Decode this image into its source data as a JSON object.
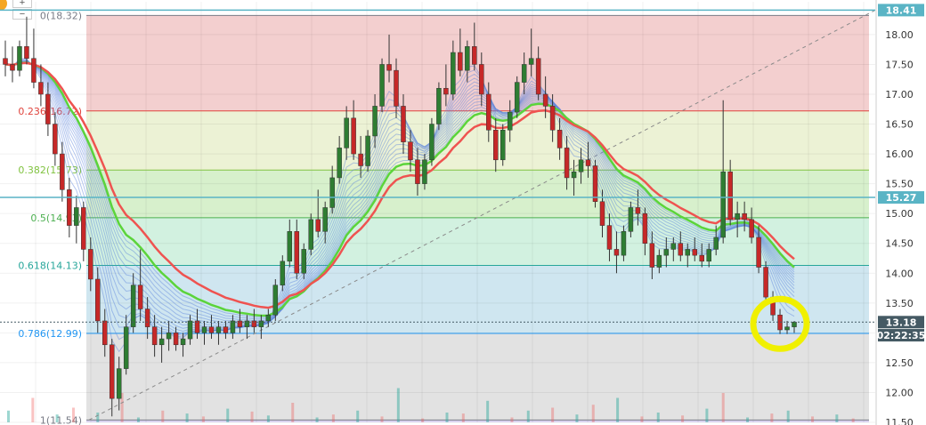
{
  "chart_data": {
    "type": "candlestick",
    "title": "",
    "ylim": [
      11.5,
      18.55
    ],
    "y_ticks": [
      "18.00",
      "17.50",
      "17.00",
      "16.50",
      "16.00",
      "15.50",
      "15.00",
      "14.50",
      "14.00",
      "13.50",
      "13.00",
      "12.50",
      "12.00",
      "11.50"
    ],
    "fib_levels": [
      {
        "label": "0(18.32)",
        "ratio": 0,
        "price": 18.32,
        "color": "#787b86"
      },
      {
        "label": "0.236(16.72)",
        "ratio": 0.236,
        "price": 16.72,
        "color": "#e0433c"
      },
      {
        "label": "0.382(15.73)",
        "ratio": 0.382,
        "price": 15.73,
        "color": "#81c341"
      },
      {
        "label": "0.5(14.93)",
        "ratio": 0.5,
        "price": 14.93,
        "color": "#4caf50"
      },
      {
        "label": "0.618(14.13)",
        "ratio": 0.618,
        "price": 14.13,
        "color": "#26a69a"
      },
      {
        "label": "0.786(12.99)",
        "ratio": 0.786,
        "price": 12.99,
        "color": "#2196f3"
      },
      {
        "label": "1(11.54)",
        "ratio": 1,
        "price": 11.54,
        "color": "#787b86"
      }
    ],
    "fib_zone_colors": [
      "#f3cfcf",
      "#ecf2d5",
      "#d7f0cc",
      "#d2f1e0",
      "#cfe6f0",
      "#e2e2e2"
    ],
    "price_tags": [
      {
        "text": "18.41",
        "price": 18.41,
        "color": "#5ab4c5"
      },
      {
        "text": "15.27",
        "price": 15.27,
        "color": "#5ab4c5"
      },
      {
        "text": "13.18",
        "price": 13.18,
        "color": "#455a64"
      },
      {
        "text": "02:22:35",
        "price": 12.96,
        "color": "#455a64"
      }
    ],
    "horizontal_lines": [
      {
        "price": 18.41,
        "color": "#5ab4c5",
        "style": "solid"
      },
      {
        "price": 15.27,
        "color": "#5ab4c5",
        "style": "solid"
      },
      {
        "price": 13.18,
        "color": "#455a64",
        "style": "dotted"
      }
    ],
    "candles": [
      [
        17.6,
        17.9,
        17.3,
        17.5
      ],
      [
        17.5,
        17.8,
        17.2,
        17.4
      ],
      [
        17.4,
        17.9,
        17.3,
        17.8
      ],
      [
        17.8,
        18.3,
        17.5,
        17.6
      ],
      [
        17.6,
        18.1,
        17.1,
        17.2
      ],
      [
        17.2,
        17.5,
        16.8,
        17.0
      ],
      [
        17.0,
        17.2,
        16.3,
        16.5
      ],
      [
        16.5,
        16.7,
        15.8,
        16.0
      ],
      [
        16.0,
        16.2,
        15.2,
        15.4
      ],
      [
        15.4,
        15.6,
        14.6,
        14.8
      ],
      [
        14.8,
        15.3,
        14.5,
        15.1
      ],
      [
        15.1,
        15.2,
        14.2,
        14.4
      ],
      [
        14.4,
        14.6,
        13.7,
        13.9
      ],
      [
        13.9,
        14.1,
        13.0,
        13.2
      ],
      [
        13.2,
        13.4,
        12.6,
        12.8
      ],
      [
        12.8,
        12.9,
        11.6,
        11.9
      ],
      [
        11.9,
        12.6,
        11.7,
        12.4
      ],
      [
        12.4,
        13.3,
        12.3,
        13.1
      ],
      [
        13.1,
        14.0,
        13.0,
        13.8
      ],
      [
        13.8,
        14.4,
        13.2,
        13.4
      ],
      [
        13.4,
        13.6,
        12.9,
        13.1
      ],
      [
        13.1,
        13.3,
        12.6,
        12.8
      ],
      [
        12.8,
        13.1,
        12.5,
        12.9
      ],
      [
        12.9,
        13.2,
        12.7,
        13.0
      ],
      [
        13.0,
        13.1,
        12.7,
        12.8
      ],
      [
        12.8,
        13.0,
        12.6,
        12.9
      ],
      [
        12.9,
        13.3,
        12.8,
        13.2
      ],
      [
        13.2,
        13.4,
        12.9,
        13.0
      ],
      [
        13.0,
        13.2,
        12.8,
        13.1
      ],
      [
        13.1,
        13.3,
        12.9,
        13.0
      ],
      [
        13.0,
        13.2,
        12.8,
        13.1
      ],
      [
        13.1,
        13.2,
        12.9,
        13.0
      ],
      [
        13.0,
        13.3,
        12.9,
        13.2
      ],
      [
        13.2,
        13.4,
        13.0,
        13.1
      ],
      [
        13.1,
        13.3,
        12.9,
        13.2
      ],
      [
        13.2,
        13.4,
        13.0,
        13.1
      ],
      [
        13.1,
        13.3,
        12.9,
        13.2
      ],
      [
        13.2,
        13.4,
        13.1,
        13.3
      ],
      [
        13.3,
        13.9,
        13.2,
        13.8
      ],
      [
        13.8,
        14.3,
        13.7,
        14.2
      ],
      [
        14.2,
        14.9,
        14.1,
        14.7
      ],
      [
        14.7,
        14.9,
        13.9,
        14.0
      ],
      [
        14.0,
        14.5,
        13.9,
        14.4
      ],
      [
        14.4,
        15.0,
        14.3,
        14.9
      ],
      [
        14.9,
        15.4,
        14.6,
        14.7
      ],
      [
        14.7,
        15.2,
        14.5,
        15.1
      ],
      [
        15.1,
        15.8,
        15.0,
        15.6
      ],
      [
        15.6,
        16.3,
        15.5,
        16.1
      ],
      [
        16.1,
        16.8,
        15.9,
        16.6
      ],
      [
        16.6,
        16.9,
        15.9,
        16.0
      ],
      [
        16.0,
        16.3,
        15.6,
        15.8
      ],
      [
        15.8,
        16.4,
        15.7,
        16.3
      ],
      [
        16.3,
        17.0,
        16.1,
        16.8
      ],
      [
        16.8,
        17.6,
        16.7,
        17.5
      ],
      [
        17.5,
        18.0,
        17.2,
        17.4
      ],
      [
        17.4,
        17.6,
        16.6,
        16.8
      ],
      [
        16.8,
        17.0,
        16.0,
        16.2
      ],
      [
        16.2,
        16.4,
        15.7,
        15.9
      ],
      [
        15.9,
        16.1,
        15.3,
        15.5
      ],
      [
        15.5,
        16.0,
        15.4,
        15.9
      ],
      [
        15.9,
        16.6,
        15.8,
        16.5
      ],
      [
        16.5,
        17.2,
        16.4,
        17.1
      ],
      [
        17.1,
        17.5,
        16.8,
        17.0
      ],
      [
        17.0,
        17.9,
        16.9,
        17.7
      ],
      [
        17.7,
        18.1,
        17.3,
        17.4
      ],
      [
        17.4,
        17.9,
        17.2,
        17.8
      ],
      [
        17.8,
        18.2,
        17.4,
        17.5
      ],
      [
        17.5,
        17.7,
        16.8,
        17.0
      ],
      [
        17.0,
        17.2,
        16.2,
        16.4
      ],
      [
        16.4,
        16.6,
        15.7,
        15.9
      ],
      [
        15.9,
        16.5,
        15.8,
        16.4
      ],
      [
        16.4,
        16.9,
        16.2,
        16.7
      ],
      [
        16.7,
        17.3,
        16.6,
        17.2
      ],
      [
        17.2,
        17.7,
        17.0,
        17.5
      ],
      [
        17.5,
        18.1,
        17.3,
        17.6
      ],
      [
        17.6,
        17.8,
        16.9,
        17.0
      ],
      [
        17.0,
        17.3,
        16.6,
        16.8
      ],
      [
        16.8,
        17.0,
        16.2,
        16.4
      ],
      [
        16.4,
        16.6,
        15.9,
        16.1
      ],
      [
        16.1,
        16.3,
        15.4,
        15.6
      ],
      [
        15.6,
        15.9,
        15.3,
        15.7
      ],
      [
        15.7,
        16.1,
        15.5,
        15.9
      ],
      [
        15.9,
        16.2,
        15.6,
        15.8
      ],
      [
        15.8,
        15.9,
        15.1,
        15.2
      ],
      [
        15.2,
        15.4,
        14.6,
        14.8
      ],
      [
        14.8,
        15.0,
        14.2,
        14.4
      ],
      [
        14.4,
        14.7,
        14.0,
        14.3
      ],
      [
        14.3,
        14.8,
        14.2,
        14.7
      ],
      [
        14.7,
        15.2,
        14.6,
        15.1
      ],
      [
        15.1,
        15.4,
        14.8,
        15.0
      ],
      [
        15.0,
        15.1,
        14.3,
        14.5
      ],
      [
        14.5,
        14.7,
        13.9,
        14.1
      ],
      [
        14.1,
        14.4,
        14.0,
        14.3
      ],
      [
        14.3,
        14.6,
        14.1,
        14.4
      ],
      [
        14.4,
        14.6,
        14.2,
        14.5
      ],
      [
        14.5,
        14.7,
        14.2,
        14.3
      ],
      [
        14.3,
        14.5,
        14.1,
        14.4
      ],
      [
        14.4,
        14.6,
        14.2,
        14.3
      ],
      [
        14.3,
        14.5,
        14.1,
        14.2
      ],
      [
        14.2,
        14.5,
        14.1,
        14.4
      ],
      [
        14.4,
        14.8,
        14.3,
        14.6
      ],
      [
        14.6,
        16.9,
        14.5,
        15.7
      ],
      [
        15.7,
        15.9,
        14.8,
        14.9
      ],
      [
        14.9,
        15.2,
        14.6,
        15.0
      ],
      [
        15.0,
        15.2,
        14.7,
        14.9
      ],
      [
        14.9,
        15.1,
        14.5,
        14.6
      ],
      [
        14.6,
        14.8,
        14.0,
        14.1
      ],
      [
        14.1,
        14.2,
        13.5,
        13.6
      ],
      [
        13.6,
        13.7,
        13.2,
        13.3
      ],
      [
        13.3,
        13.4,
        12.98,
        13.05
      ],
      [
        13.05,
        13.2,
        12.98,
        13.1
      ],
      [
        13.1,
        13.2,
        13.0,
        13.18
      ]
    ],
    "volume_bars": [
      0.12,
      0.25,
      0.08,
      0.15,
      0.1,
      0.3,
      0.05,
      0.12,
      0.09,
      0.06,
      0.14,
      0.11,
      0.07,
      0.2,
      0.05,
      0.08,
      0.12,
      0.06,
      0.35,
      0.04,
      0.1,
      0.09,
      0.22,
      0.05,
      0.12,
      0.15,
      0.08,
      0.18,
      0.25,
      0.06,
      0.1,
      0.07,
      0.14,
      0.3,
      0.05,
      0.09,
      0.12,
      0.06,
      0.08,
      0.04
    ],
    "circle_highlight": {
      "color": "#f0f000"
    }
  },
  "toolbar": {
    "zoom_in_label": "+",
    "zoom_out_label": "−"
  }
}
